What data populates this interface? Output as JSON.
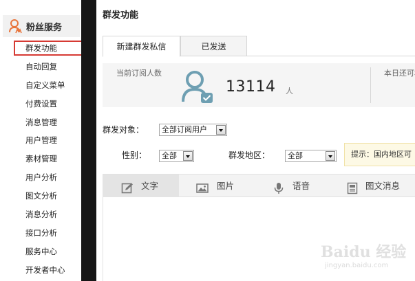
{
  "sidebar": {
    "header": "粉丝服务",
    "items": [
      {
        "label": "群发功能",
        "active": true
      },
      {
        "label": "自动回复"
      },
      {
        "label": "自定义菜单"
      },
      {
        "label": "付费设置"
      },
      {
        "label": "消息管理"
      },
      {
        "label": "用户管理"
      },
      {
        "label": "素材管理"
      },
      {
        "label": "用户分析"
      },
      {
        "label": "图文分析"
      },
      {
        "label": "消息分析"
      },
      {
        "label": "接口分析"
      },
      {
        "label": "服务中心"
      },
      {
        "label": "开发者中心"
      }
    ]
  },
  "page": {
    "title": "群发功能",
    "tabs": [
      "新建群发私信",
      "已发送"
    ]
  },
  "stats": {
    "subscribers_label": "当前订阅人数",
    "subscribers_count": "13114",
    "subscribers_unit": "人",
    "remaining_label": "本日还可群"
  },
  "form": {
    "target_label": "群发对象：",
    "target_value": "全部订阅用户",
    "gender_label": "性别：",
    "gender_value": "全部",
    "region_label": "群发地区：",
    "region_value": "全部",
    "tip": "提示：国内地区可"
  },
  "editor_tabs": [
    {
      "label": "文字",
      "icon": "edit-icon",
      "active": true
    },
    {
      "label": "图片",
      "icon": "image-icon"
    },
    {
      "label": "语音",
      "icon": "microphone-icon"
    },
    {
      "label": "图文消息",
      "icon": "article-icon"
    }
  ],
  "watermark": {
    "main": "Baidu 经验",
    "sub": "jingyan.baidu.com"
  },
  "colors": {
    "accent_red": "#d63a33",
    "logo_orange": "#e8743b",
    "avatar_teal": "#6e9fb2",
    "sidebar_divider": "#161616"
  }
}
